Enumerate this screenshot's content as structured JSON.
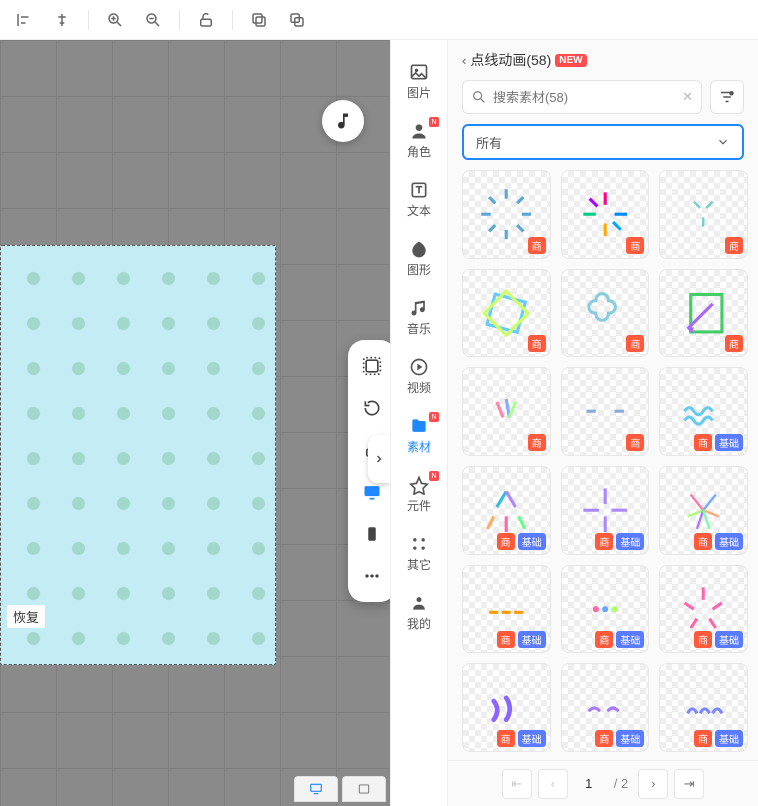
{
  "toolbar": {
    "icons": [
      "align-left",
      "align-center",
      "zoom-in",
      "zoom-out",
      "unlock",
      "copy",
      "duplicate"
    ]
  },
  "canvas": {
    "restore_label": "恢复"
  },
  "categories": [
    {
      "key": "image",
      "label": "图片",
      "active": false,
      "new": false
    },
    {
      "key": "role",
      "label": "角色",
      "active": false,
      "new": true
    },
    {
      "key": "text",
      "label": "文本",
      "active": false,
      "new": false
    },
    {
      "key": "shape",
      "label": "图形",
      "active": false,
      "new": false
    },
    {
      "key": "music",
      "label": "音乐",
      "active": false,
      "new": false
    },
    {
      "key": "video",
      "label": "视频",
      "active": false,
      "new": false
    },
    {
      "key": "material",
      "label": "素材",
      "active": true,
      "new": true
    },
    {
      "key": "component",
      "label": "元件",
      "active": false,
      "new": true
    },
    {
      "key": "other",
      "label": "其它",
      "active": false,
      "new": false
    },
    {
      "key": "mine",
      "label": "我的",
      "active": false,
      "new": false
    }
  ],
  "panel": {
    "back_glyph": "‹",
    "title": "点线动画(58)",
    "new_badge": "NEW",
    "search_placeholder": "搜索素材(58)",
    "dropdown_label": "所有",
    "tags": {
      "shang": "商",
      "jichu": "基础"
    },
    "assets": [
      {
        "tags": [
          "shang"
        ]
      },
      {
        "tags": [
          "shang"
        ]
      },
      {
        "tags": [
          "shang"
        ]
      },
      {
        "tags": [
          "shang"
        ]
      },
      {
        "tags": [
          "shang"
        ]
      },
      {
        "tags": [
          "shang"
        ]
      },
      {
        "tags": [
          "shang"
        ]
      },
      {
        "tags": [
          "shang"
        ]
      },
      {
        "tags": [
          "shang",
          "jichu"
        ]
      },
      {
        "tags": [
          "shang",
          "jichu"
        ]
      },
      {
        "tags": [
          "shang",
          "jichu"
        ]
      },
      {
        "tags": [
          "shang",
          "jichu"
        ]
      },
      {
        "tags": [
          "shang",
          "jichu"
        ]
      },
      {
        "tags": [
          "shang",
          "jichu"
        ]
      },
      {
        "tags": [
          "shang",
          "jichu"
        ]
      },
      {
        "tags": [
          "shang",
          "jichu"
        ]
      },
      {
        "tags": [
          "shang",
          "jichu"
        ]
      },
      {
        "tags": [
          "shang",
          "jichu"
        ]
      }
    ],
    "pager": {
      "current": "1",
      "sep": "/",
      "total": "2"
    }
  }
}
